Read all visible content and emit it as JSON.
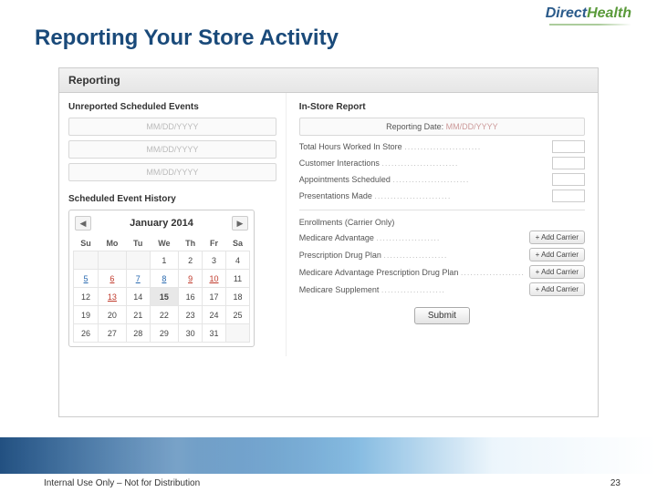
{
  "brand": {
    "part1": "Direct",
    "part2": "Health"
  },
  "slide_title": "Reporting Your Store Activity",
  "app": {
    "header": "Reporting",
    "left": {
      "unreported_title": "Unreported Scheduled Events",
      "date_placeholder": "MM/DD/YYYY",
      "history_title": "Scheduled Event History",
      "calendar": {
        "month_label": "January 2014",
        "dow": [
          "Su",
          "Mo",
          "Tu",
          "We",
          "Th",
          "Fr",
          "Sa"
        ],
        "prev_glyph": "◀",
        "next_glyph": "▶",
        "cells": [
          {
            "t": "",
            "c": "empty"
          },
          {
            "t": "",
            "c": "empty"
          },
          {
            "t": "",
            "c": "empty"
          },
          {
            "t": "1"
          },
          {
            "t": "2"
          },
          {
            "t": "3"
          },
          {
            "t": "4"
          },
          {
            "t": "5",
            "c": "link"
          },
          {
            "t": "6",
            "c": "busy"
          },
          {
            "t": "7",
            "c": "link"
          },
          {
            "t": "8",
            "c": "link"
          },
          {
            "t": "9",
            "c": "busy"
          },
          {
            "t": "10",
            "c": "busy"
          },
          {
            "t": "11"
          },
          {
            "t": "12"
          },
          {
            "t": "13",
            "c": "busy"
          },
          {
            "t": "14"
          },
          {
            "t": "15",
            "c": "today"
          },
          {
            "t": "16"
          },
          {
            "t": "17"
          },
          {
            "t": "18"
          },
          {
            "t": "19"
          },
          {
            "t": "20"
          },
          {
            "t": "21"
          },
          {
            "t": "22"
          },
          {
            "t": "23"
          },
          {
            "t": "24"
          },
          {
            "t": "25"
          },
          {
            "t": "26"
          },
          {
            "t": "27"
          },
          {
            "t": "28"
          },
          {
            "t": "29"
          },
          {
            "t": "30"
          },
          {
            "t": "31"
          },
          {
            "t": "",
            "c": "empty"
          }
        ]
      }
    },
    "right": {
      "title": "In-Store Report",
      "reporting_date_label": "Reporting Date:",
      "reporting_date_value": "MM/DD/YYYY",
      "fields": [
        "Total Hours Worked In Store",
        "Customer Interactions",
        "Appointments Scheduled",
        "Presentations Made"
      ],
      "enrollments_title": "Enrollments (Carrier Only)",
      "enrollment_rows": [
        "Medicare Advantage",
        "Prescription Drug Plan",
        "Medicare Advantage Prescription Drug Plan",
        "Medicare Supplement"
      ],
      "add_carrier_label": "+ Add Carrier",
      "submit_label": "Submit"
    }
  },
  "footer": {
    "text": "Internal Use Only – Not for Distribution",
    "page": "23"
  }
}
